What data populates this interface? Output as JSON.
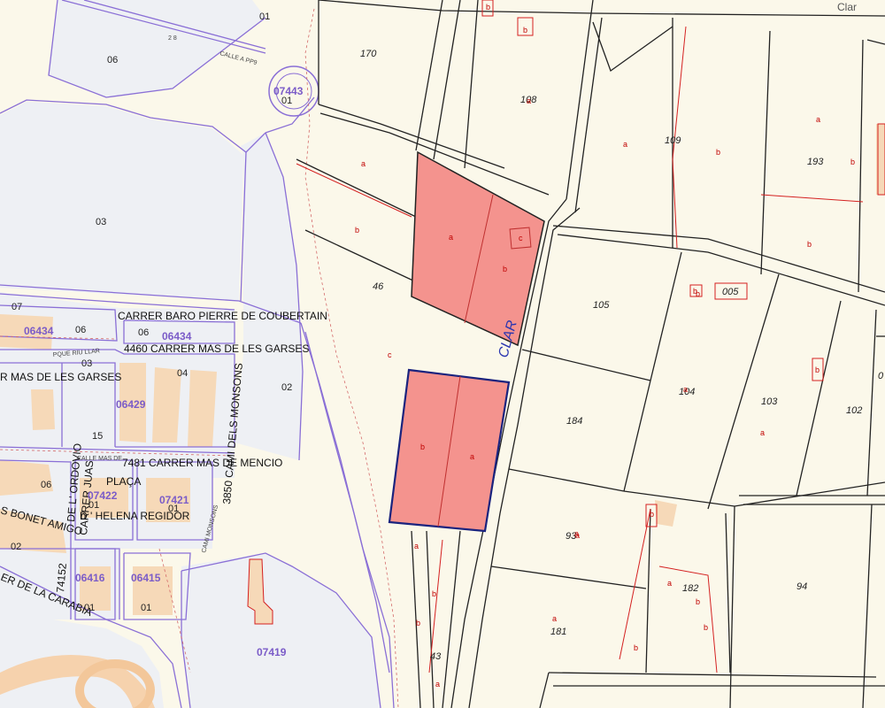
{
  "map": {
    "colors": {
      "background": "#fbf8ea",
      "urban": "#eef0f4",
      "block_outline": "#8a6fd6",
      "parcel_line": "#222222",
      "subparcel_line": "#d42020",
      "highlight_fill": "#f4938e",
      "highlight_outline": "#1a237e",
      "building": "#f6d9b8",
      "road_fill": "#f3c79a"
    },
    "top_right_label": "Clar",
    "road_name": "CLAR",
    "streets": [
      "CALLE A PP9",
      "CARRER BARO PIERRE DE COUBERTAIN",
      "4460 CARRER MAS DE LES GARSES",
      "R MAS DE LES GARSES",
      "PQUE RIU LLAR",
      "CALLE MAS DE",
      "7481 CARRER MAS DE MENCIO",
      "3850 CAMI DELS MONSONS",
      "CAMI MONSONS",
      "DE L' ORDOVIO",
      "CARRER JUAS",
      "PLAÇA",
      "D ' HELENA REGIDOR",
      "S BONET AMIGO",
      "74152",
      "ER DE LA CARABIA"
    ],
    "block_codes": [
      "07443",
      "06434",
      "06434",
      "06429",
      "07422",
      "07421",
      "06416",
      "06415",
      "07419"
    ],
    "urban_numbers": [
      "01",
      "06",
      "01",
      "03",
      "07",
      "06",
      "06",
      "03",
      "04",
      "02",
      "15",
      "06",
      "01",
      "01",
      "02",
      "01",
      "01",
      "2 8"
    ],
    "parcel_numbers": [
      "170",
      "108",
      "109",
      "193",
      "46",
      "105",
      "005",
      "184",
      "104",
      "103",
      "102",
      "93",
      "182",
      "94",
      "181",
      "43",
      "0"
    ],
    "subparcel_letters": [
      "b",
      "a",
      "b",
      "a",
      "a",
      "c",
      "b",
      "a",
      "b",
      "b",
      "b",
      "a",
      "c",
      "b",
      "a",
      "a",
      "a",
      "b",
      "a",
      "b",
      "a",
      "b",
      "b",
      "a",
      "b",
      "b",
      "a",
      "b",
      "a",
      "b",
      "b",
      "b",
      "a"
    ]
  }
}
